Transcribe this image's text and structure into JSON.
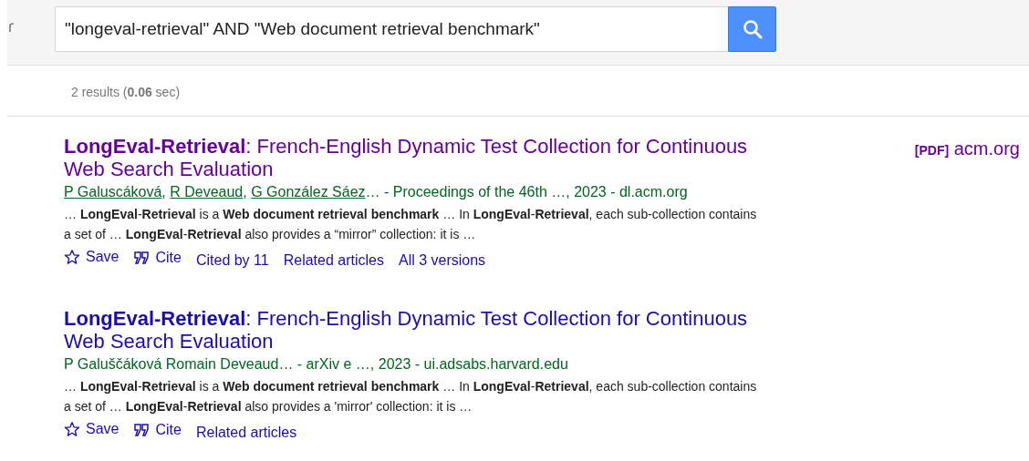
{
  "search": {
    "value": "\"longeval-retrieval\" AND \"Web document retrieval benchmark\""
  },
  "result_stats": "2 results (**0.06** sec)",
  "results": [
    {
      "title": "**LongEval-Retrieval**: French-English Dynamic Test Collection for Continuous Web Search Evaluation",
      "visited": true,
      "side_link": {
        "tag": "[PDF]",
        "domain": "acm.org"
      },
      "meta": [
        {
          "text": "P Galuscáková",
          "link": true
        },
        {
          "text": ", ",
          "link": false
        },
        {
          "text": "R Deveaud",
          "link": true
        },
        {
          "text": ", ",
          "link": false
        },
        {
          "text": "G González Sáez",
          "link": true
        },
        {
          "text": "… - Proceedings of the 46th …, 2023 - dl.acm.org",
          "link": false
        }
      ],
      "snippet": "… **LongEval**-**Retrieval** is a **Web document retrieval benchmark** … In **LongEval**-**Retrieval**, each sub-collection contains a set of … **LongEval**-**Retrieval** also provides a “mirror” collection: it is …",
      "actions": [
        {
          "kind": "save",
          "label": "Save"
        },
        {
          "kind": "cite",
          "label": "Cite"
        },
        {
          "kind": "link",
          "label": "Cited by 11"
        },
        {
          "kind": "link",
          "label": "Related articles"
        },
        {
          "kind": "link",
          "label": "All 3 versions"
        }
      ]
    },
    {
      "title": "**LongEval-Retrieval**: French-English Dynamic Test Collection for Continuous Web Search Evaluation",
      "visited": false,
      "meta": [
        {
          "text": "P Galuščáková Romain Deveaud… - arXiv e …, 2023 - ui.adsabs.harvard.edu",
          "link": false
        }
      ],
      "snippet": "… **LongEval**-**Retrieval** is a **Web document retrieval benchmark** … In **LongEval**-**Retrieval**, each sub-collection contains a set of … **LongEval**-**Retrieval** also provides a 'mirror' collection: it is …",
      "actions": [
        {
          "kind": "save",
          "label": "Save"
        },
        {
          "kind": "cite",
          "label": "Cite"
        },
        {
          "kind": "link",
          "label": "Related articles"
        }
      ]
    }
  ]
}
